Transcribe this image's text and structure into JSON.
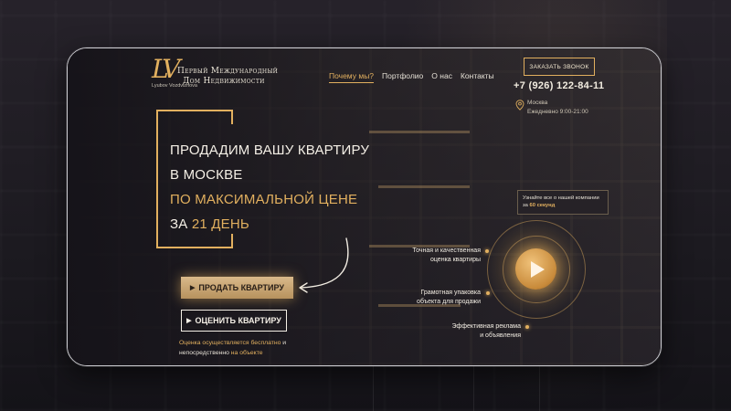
{
  "logo": {
    "mark": "LV",
    "subtitle": "Lyubov Vozdvizhova",
    "title_line1": "Первый Международный",
    "title_line2": "Дом Недвижимости"
  },
  "nav": {
    "items": [
      {
        "label": "Почему мы?",
        "active": true
      },
      {
        "label": "Портфолио",
        "active": false
      },
      {
        "label": "О нас",
        "active": false
      },
      {
        "label": "Контакты",
        "active": false
      }
    ]
  },
  "header": {
    "call_button": "Заказать звонок",
    "phone": "+7 (926) 122-84-11",
    "city": "Москва",
    "hours": "Ежедневно 9:00-21:00"
  },
  "hero": {
    "line1": "Продадим вашу квартиру",
    "line2": "в Москве",
    "line3": "по максимальной цене",
    "line4_prefix": "за",
    "line4_highlight": "21 день"
  },
  "buttons": {
    "sell": "ПРОДАТЬ КВАРТИРУ",
    "evaluate": "ОЦЕНИТЬ КВАРТИРУ"
  },
  "note": {
    "part1": "Оценка осуществляется",
    "part2": "бесплатно",
    "part3": "и",
    "part4": "непосредственно",
    "part5": "на объекте"
  },
  "video": {
    "tooltip_line1": "Узнайте все о нашей компании",
    "tooltip_prefix": "за",
    "tooltip_highlight": "60 секунд",
    "features": [
      {
        "line1": "Точная и качественная",
        "line2": "оценка квартиры"
      },
      {
        "line1": "Грамотная упаковка",
        "line2": "объекта для продажи"
      },
      {
        "line1": "Эффективная реклама",
        "line2": "и объявления"
      }
    ]
  },
  "colors": {
    "accent": "#e2b05f",
    "text": "#f4efe6",
    "background": "#1c1a20"
  }
}
